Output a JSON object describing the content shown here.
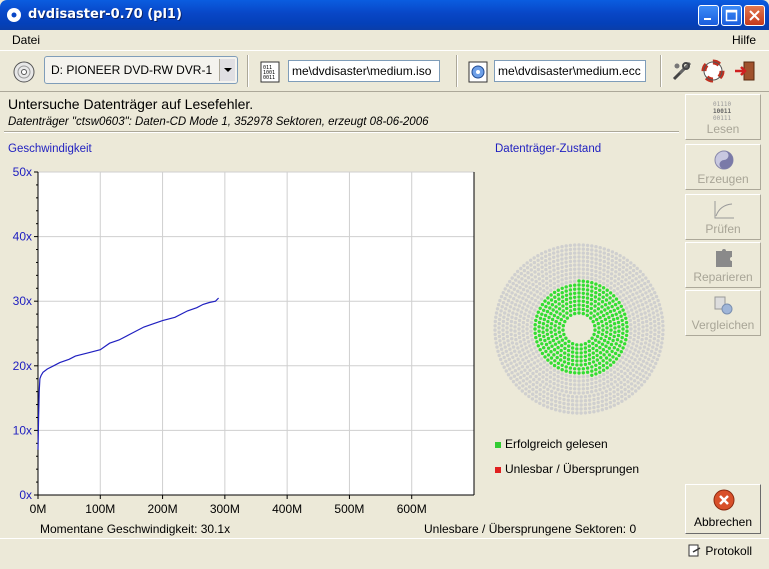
{
  "window": {
    "title": "dvdisaster-0.70 (pl1)"
  },
  "menu": {
    "left": "Datei",
    "right": "Hilfe"
  },
  "toolbar": {
    "drive": "D: PIONEER DVD-RW DVR-1",
    "image_file": "me\\dvdisaster\\medium.iso",
    "ecc_file": "me\\dvdisaster\\medium.ecc"
  },
  "status": {
    "title": "Untersuche Datenträger auf Lesefehler.",
    "subtitle": "Datenträger \"ctsw0603\": Daten-CD Mode 1, 352978 Sektoren, erzeugt 08-06-2006"
  },
  "labels": {
    "speed": "Geschwindigkeit",
    "medium_state": "Datenträger-Zustand"
  },
  "side_buttons": [
    "Lesen",
    "Erzeugen",
    "Prüfen",
    "Reparieren",
    "Vergleichen"
  ],
  "abort_label": "Abbrechen",
  "legend": {
    "ok": "Erfolgreich gelesen",
    "ok_color": "#33cc33",
    "bad": "Unlesbar / Übersprungen",
    "bad_color": "#e02020"
  },
  "footer": {
    "current_speed": "Momentane Geschwindigkeit: 30.1x",
    "unreadable": "Unlesbare / Übersprungene Sektoren: 0",
    "log": "Protokoll"
  },
  "chart_data": {
    "type": "line",
    "title": "",
    "xlabel": "",
    "ylabel": "",
    "xlim": [
      0,
      700
    ],
    "ylim": [
      0,
      50
    ],
    "x_tick_labels": [
      "0M",
      "100M",
      "200M",
      "300M",
      "400M",
      "500M",
      "600M"
    ],
    "y_tick_labels": [
      "0x",
      "10x",
      "20x",
      "30x",
      "40x",
      "50x"
    ],
    "series": [
      {
        "color": "#2020c0",
        "x": [
          0,
          1,
          2,
          3,
          5,
          8,
          15,
          25,
          35,
          50,
          60,
          80,
          100,
          115,
          130,
          150,
          170,
          185,
          200,
          220,
          240,
          255,
          265,
          275,
          285,
          290
        ],
        "y": [
          7,
          12,
          16,
          18,
          18.5,
          19,
          19.5,
          20,
          20.5,
          21,
          21.5,
          22,
          22.5,
          23.5,
          24,
          25,
          26,
          26.5,
          27,
          27.5,
          28.5,
          29,
          29.5,
          29.8,
          30,
          30.5
        ]
      }
    ]
  },
  "disc": {
    "read_fraction": 0.47,
    "read_color": "#33dd33",
    "empty_color": "#cfcfcf"
  }
}
